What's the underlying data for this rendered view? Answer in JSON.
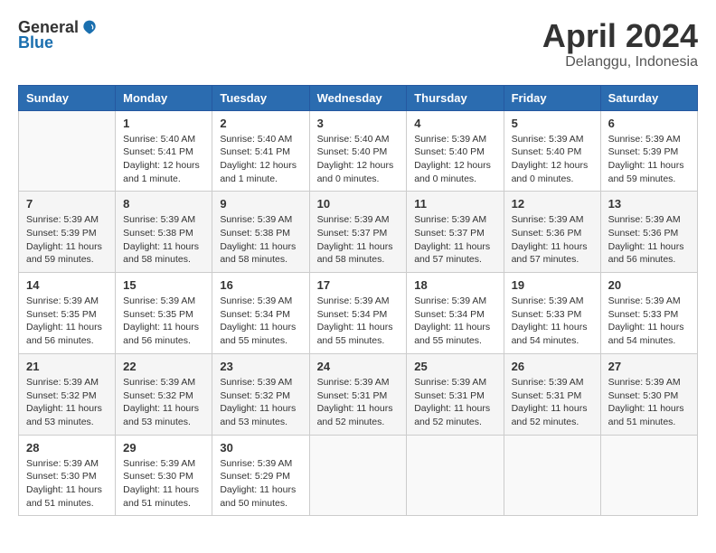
{
  "header": {
    "logo_general": "General",
    "logo_blue": "Blue",
    "month_year": "April 2024",
    "location": "Delanggu, Indonesia"
  },
  "weekdays": [
    "Sunday",
    "Monday",
    "Tuesday",
    "Wednesday",
    "Thursday",
    "Friday",
    "Saturday"
  ],
  "weeks": [
    [
      {
        "day": "",
        "info": ""
      },
      {
        "day": "1",
        "info": "Sunrise: 5:40 AM\nSunset: 5:41 PM\nDaylight: 12 hours\nand 1 minute."
      },
      {
        "day": "2",
        "info": "Sunrise: 5:40 AM\nSunset: 5:41 PM\nDaylight: 12 hours\nand 1 minute."
      },
      {
        "day": "3",
        "info": "Sunrise: 5:40 AM\nSunset: 5:40 PM\nDaylight: 12 hours\nand 0 minutes."
      },
      {
        "day": "4",
        "info": "Sunrise: 5:39 AM\nSunset: 5:40 PM\nDaylight: 12 hours\nand 0 minutes."
      },
      {
        "day": "5",
        "info": "Sunrise: 5:39 AM\nSunset: 5:40 PM\nDaylight: 12 hours\nand 0 minutes."
      },
      {
        "day": "6",
        "info": "Sunrise: 5:39 AM\nSunset: 5:39 PM\nDaylight: 11 hours\nand 59 minutes."
      }
    ],
    [
      {
        "day": "7",
        "info": "Sunrise: 5:39 AM\nSunset: 5:39 PM\nDaylight: 11 hours\nand 59 minutes."
      },
      {
        "day": "8",
        "info": "Sunrise: 5:39 AM\nSunset: 5:38 PM\nDaylight: 11 hours\nand 58 minutes."
      },
      {
        "day": "9",
        "info": "Sunrise: 5:39 AM\nSunset: 5:38 PM\nDaylight: 11 hours\nand 58 minutes."
      },
      {
        "day": "10",
        "info": "Sunrise: 5:39 AM\nSunset: 5:37 PM\nDaylight: 11 hours\nand 58 minutes."
      },
      {
        "day": "11",
        "info": "Sunrise: 5:39 AM\nSunset: 5:37 PM\nDaylight: 11 hours\nand 57 minutes."
      },
      {
        "day": "12",
        "info": "Sunrise: 5:39 AM\nSunset: 5:36 PM\nDaylight: 11 hours\nand 57 minutes."
      },
      {
        "day": "13",
        "info": "Sunrise: 5:39 AM\nSunset: 5:36 PM\nDaylight: 11 hours\nand 56 minutes."
      }
    ],
    [
      {
        "day": "14",
        "info": "Sunrise: 5:39 AM\nSunset: 5:35 PM\nDaylight: 11 hours\nand 56 minutes."
      },
      {
        "day": "15",
        "info": "Sunrise: 5:39 AM\nSunset: 5:35 PM\nDaylight: 11 hours\nand 56 minutes."
      },
      {
        "day": "16",
        "info": "Sunrise: 5:39 AM\nSunset: 5:34 PM\nDaylight: 11 hours\nand 55 minutes."
      },
      {
        "day": "17",
        "info": "Sunrise: 5:39 AM\nSunset: 5:34 PM\nDaylight: 11 hours\nand 55 minutes."
      },
      {
        "day": "18",
        "info": "Sunrise: 5:39 AM\nSunset: 5:34 PM\nDaylight: 11 hours\nand 55 minutes."
      },
      {
        "day": "19",
        "info": "Sunrise: 5:39 AM\nSunset: 5:33 PM\nDaylight: 11 hours\nand 54 minutes."
      },
      {
        "day": "20",
        "info": "Sunrise: 5:39 AM\nSunset: 5:33 PM\nDaylight: 11 hours\nand 54 minutes."
      }
    ],
    [
      {
        "day": "21",
        "info": "Sunrise: 5:39 AM\nSunset: 5:32 PM\nDaylight: 11 hours\nand 53 minutes."
      },
      {
        "day": "22",
        "info": "Sunrise: 5:39 AM\nSunset: 5:32 PM\nDaylight: 11 hours\nand 53 minutes."
      },
      {
        "day": "23",
        "info": "Sunrise: 5:39 AM\nSunset: 5:32 PM\nDaylight: 11 hours\nand 53 minutes."
      },
      {
        "day": "24",
        "info": "Sunrise: 5:39 AM\nSunset: 5:31 PM\nDaylight: 11 hours\nand 52 minutes."
      },
      {
        "day": "25",
        "info": "Sunrise: 5:39 AM\nSunset: 5:31 PM\nDaylight: 11 hours\nand 52 minutes."
      },
      {
        "day": "26",
        "info": "Sunrise: 5:39 AM\nSunset: 5:31 PM\nDaylight: 11 hours\nand 52 minutes."
      },
      {
        "day": "27",
        "info": "Sunrise: 5:39 AM\nSunset: 5:30 PM\nDaylight: 11 hours\nand 51 minutes."
      }
    ],
    [
      {
        "day": "28",
        "info": "Sunrise: 5:39 AM\nSunset: 5:30 PM\nDaylight: 11 hours\nand 51 minutes."
      },
      {
        "day": "29",
        "info": "Sunrise: 5:39 AM\nSunset: 5:30 PM\nDaylight: 11 hours\nand 51 minutes."
      },
      {
        "day": "30",
        "info": "Sunrise: 5:39 AM\nSunset: 5:29 PM\nDaylight: 11 hours\nand 50 minutes."
      },
      {
        "day": "",
        "info": ""
      },
      {
        "day": "",
        "info": ""
      },
      {
        "day": "",
        "info": ""
      },
      {
        "day": "",
        "info": ""
      }
    ]
  ]
}
